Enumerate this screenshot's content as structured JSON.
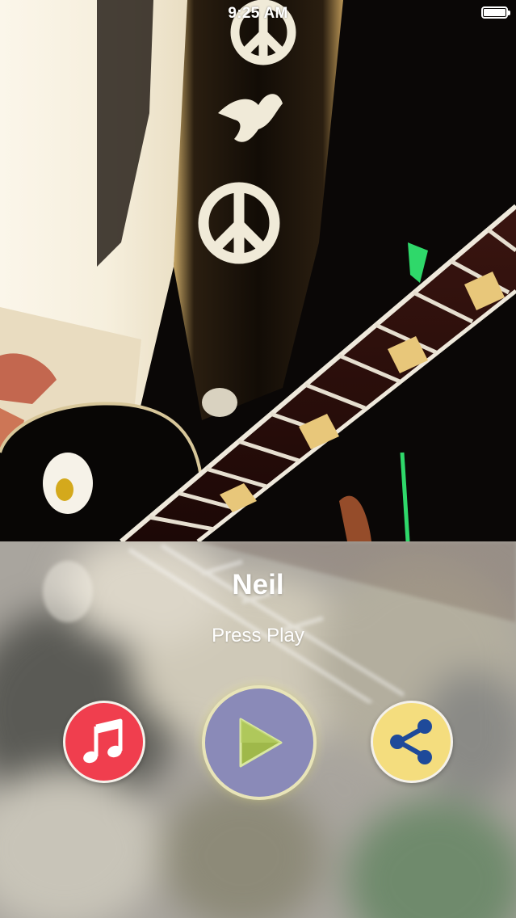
{
  "status_bar": {
    "time": "9:25 AM",
    "battery_icon": "battery-full-icon"
  },
  "artwork": {
    "description_icon": "album-artwork"
  },
  "now_playing": {
    "title": "Neil",
    "subtitle": "Press Play"
  },
  "controls": {
    "music_icon": "music-note-icon",
    "play_icon": "play-icon",
    "share_icon": "share-icon"
  },
  "colors": {
    "music_button": "#f03e4e",
    "play_button": "#8a8ab8",
    "play_triangle": "#9fb84a",
    "share_button": "#f4dd7e",
    "share_glyph": "#1e4a9a",
    "panel_background": "#a9a59e"
  }
}
